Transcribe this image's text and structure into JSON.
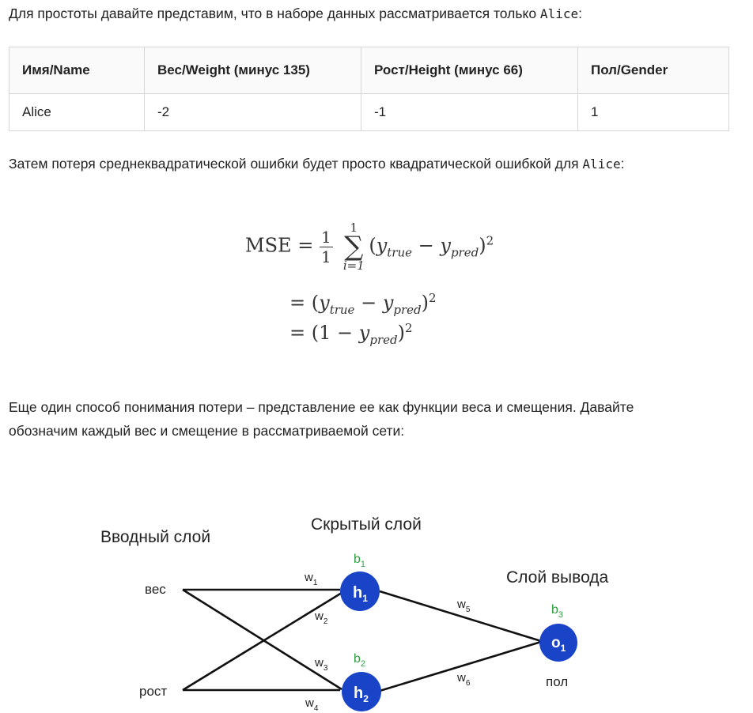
{
  "intro": {
    "text": "Для простоты давайте представим, что в наборе данных рассматривается только ",
    "code": "Alice",
    "end": ":"
  },
  "table": {
    "headers": [
      "Имя/Name",
      "Вес/Weight (минус 135)",
      "Рост/Height (минус 66)",
      "Пол/Gender"
    ],
    "rows": [
      [
        "Alice",
        "-2",
        "-1",
        "1"
      ]
    ]
  },
  "mse_text": {
    "text": "Затем потеря среднеквадратической ошибки будет просто квадратической ошибкой для ",
    "code": "Alice",
    "end": ":"
  },
  "formula": {
    "mse": "MSE",
    "eq": "=",
    "frac_num": "1",
    "frac_den": "1",
    "sum_top": "1",
    "sum_sym": "∑",
    "sum_bot": "i=1",
    "y": "y",
    "true": "true",
    "pred": "pred",
    "minus": "−",
    "sq": "2",
    "one": "1",
    "lparen": "(",
    "rparen": ")"
  },
  "loss_text": {
    "line1": "Еще один способ понимания потери – представление ее как функции веса и смещения. Давайте",
    "line2": "обозначим каждый вес и смещение в рассматриваемой сети:"
  },
  "diagram": {
    "input_layer": "Вводный слой",
    "hidden_layer": "Скрытый слой",
    "output_layer": "Слой вывода",
    "input_weight": "вес",
    "input_height": "рост",
    "output_gender": "пол",
    "w_letter": "w",
    "w_subs": [
      "1",
      "2",
      "3",
      "4",
      "5",
      "6"
    ],
    "b_letter": "b",
    "b_subs": [
      "1",
      "2",
      "3"
    ],
    "h_letter": "h",
    "h_subs": [
      "1",
      "2"
    ],
    "o_letter": "o",
    "o_sub": "1",
    "colors": {
      "node": "#1a44c8",
      "bias": "#2e9e3e",
      "line": "#111111"
    }
  }
}
